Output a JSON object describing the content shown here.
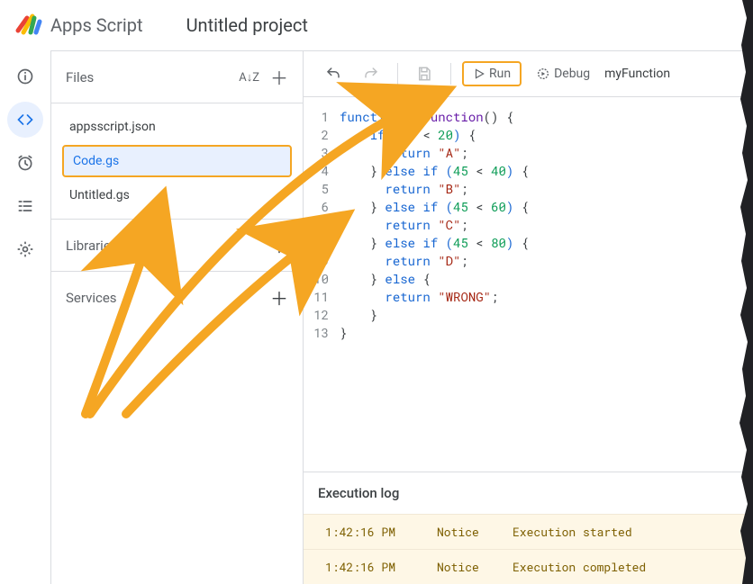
{
  "header": {
    "app_name": "Apps Script",
    "project_title": "Untitled project"
  },
  "files_panel": {
    "title": "Files",
    "items": [
      "appsscript.json",
      "Code.gs",
      "Untitled.gs"
    ],
    "selected_index": 1,
    "libraries_label": "Libraries",
    "services_label": "Services"
  },
  "toolbar": {
    "run_label": "Run",
    "debug_label": "Debug",
    "function_name": "myFunction"
  },
  "code": {
    "lines": [
      {
        "n": 1,
        "html": "<span class='kw'>function</span> <span class='fn'>myFunction</span>() {"
      },
      {
        "n": 2,
        "html": "    <span class='kw'>if</span> <span class='paren'>(</span><span class='num'>45</span> &lt; <span class='num'>20</span><span class='paren'>)</span> {"
      },
      {
        "n": 3,
        "html": "      <span class='kw'>return</span> <span class='str'>\"A\"</span>;"
      },
      {
        "n": 4,
        "html": "    } <span class='kw'>else if</span> <span class='paren'>(</span><span class='num'>45</span> &lt; <span class='num'>40</span><span class='paren'>)</span> {"
      },
      {
        "n": 5,
        "html": "      <span class='kw'>return</span> <span class='str'>\"B\"</span>;"
      },
      {
        "n": 6,
        "html": "    } <span class='kw'>else if</span> <span class='paren'>(</span><span class='num'>45</span> &lt; <span class='num'>60</span><span class='paren'>)</span> {"
      },
      {
        "n": 7,
        "html": "      <span class='kw'>return</span> <span class='str'>\"C\"</span>;"
      },
      {
        "n": 8,
        "html": "    } <span class='kw'>else if</span> <span class='paren'>(</span><span class='num'>45</span> &lt; <span class='num'>80</span><span class='paren'>)</span> {"
      },
      {
        "n": 9,
        "html": "      <span class='kw'>return</span> <span class='str'>\"D\"</span>;"
      },
      {
        "n": 10,
        "html": "    } <span class='kw'>else</span> {"
      },
      {
        "n": 11,
        "html": "      <span class='kw'>return</span> <span class='str'>\"WRONG\"</span>;"
      },
      {
        "n": 12,
        "html": "    }"
      },
      {
        "n": 13,
        "html": "}"
      }
    ]
  },
  "exec_log": {
    "title": "Execution log",
    "rows": [
      {
        "time": "1:42:16 PM",
        "level": "Notice",
        "msg": "Execution started"
      },
      {
        "time": "1:42:16 PM",
        "level": "Notice",
        "msg": "Execution completed"
      }
    ]
  }
}
